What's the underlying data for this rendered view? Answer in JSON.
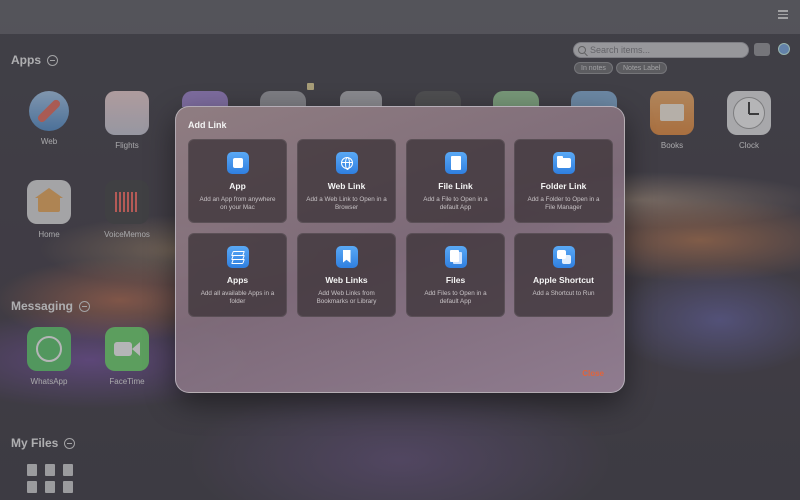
{
  "sections": {
    "apps": "Apps",
    "messaging": "Messaging",
    "my_files": "My Files"
  },
  "search": {
    "placeholder": "Search items..."
  },
  "chips": {
    "in_notes": "In notes",
    "notes_label": "Notes Label"
  },
  "apps": [
    {
      "label": "Web",
      "icon": "safari-icon"
    },
    {
      "label": "Flights",
      "icon": "flights-icon"
    },
    {
      "label": "Books",
      "icon": "books-icon"
    },
    {
      "label": "Clock",
      "icon": "clock-icon"
    },
    {
      "label": "Home",
      "icon": "home-icon"
    },
    {
      "label": "VoiceMemos",
      "icon": "voice-memos-icon"
    }
  ],
  "messaging_apps": [
    {
      "label": "WhatsApp",
      "icon": "whatsapp-icon"
    },
    {
      "label": "FaceTime",
      "icon": "facetime-icon"
    }
  ],
  "modal": {
    "title": "Add Link",
    "close_label": "Close",
    "cards": [
      {
        "title": "App",
        "desc": "Add an App from anywhere on your Mac",
        "icon": "app-icon"
      },
      {
        "title": "Web Link",
        "desc": "Add a Web Link to Open in a Browser",
        "icon": "globe-icon"
      },
      {
        "title": "File Link",
        "desc": "Add a File to Open in a default App",
        "icon": "file-icon"
      },
      {
        "title": "Folder Link",
        "desc": "Add a Folder to Open in a File Manager",
        "icon": "folder-icon"
      },
      {
        "title": "Apps",
        "desc": "Add all available Apps in a folder",
        "icon": "layers-icon"
      },
      {
        "title": "Web Links",
        "desc": "Add Web Links from Bookmarks or Library",
        "icon": "bookmark-icon"
      },
      {
        "title": "Files",
        "desc": "Add Files to Open in a default App",
        "icon": "files-icon"
      },
      {
        "title": "Apple Shortcut",
        "desc": "Add a Shortcut to Run",
        "icon": "shortcut-icon"
      }
    ]
  },
  "colors": {
    "accent": "#2f7fe0",
    "close": "#e0643c"
  }
}
